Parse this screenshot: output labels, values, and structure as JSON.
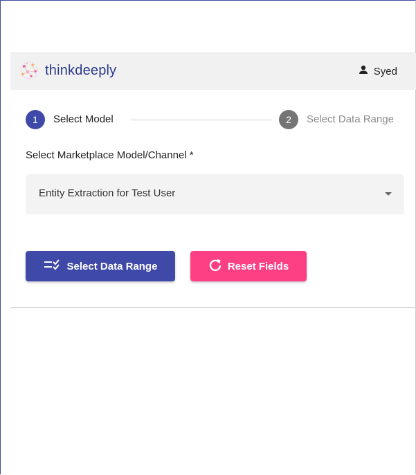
{
  "header": {
    "logo_text": "thinkdeeply",
    "user_name": "Syed"
  },
  "stepper": {
    "steps": [
      {
        "number": "1",
        "label": "Select Model",
        "active": true
      },
      {
        "number": "2",
        "label": "Select Data Range",
        "active": false
      }
    ]
  },
  "form": {
    "field_label": "Select Marketplace Model/Channel *",
    "selected_value": "Entity Extraction for Test User"
  },
  "actions": {
    "primary_label": "Select Data Range",
    "reset_label": "Reset Fields"
  },
  "colors": {
    "primary": "#3f4aa8",
    "reset": "#fd3f84",
    "inactive_step": "#757575",
    "header_bg": "#f1f1f1"
  },
  "icons": {
    "logo": "neural-network-icon",
    "user": "person-icon",
    "primary_button": "checklist-icon",
    "reset_button": "refresh-icon",
    "select": "caret-down-icon"
  }
}
